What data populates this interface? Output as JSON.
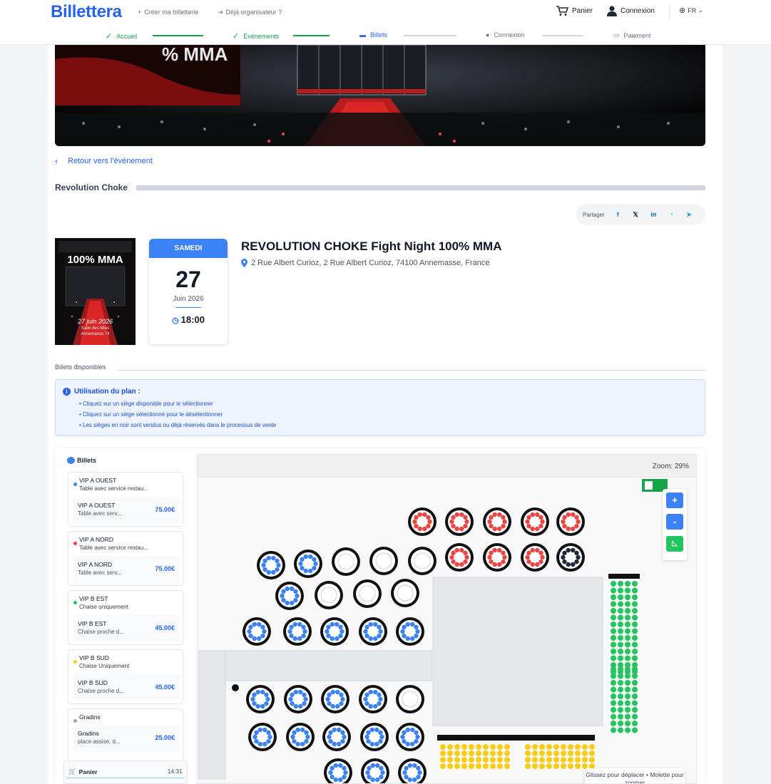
{
  "header": {
    "logo": "Billettera",
    "create_link": "Créer ma billetterie",
    "organizer_link": "Déjà organisateur ?",
    "cart": "Panier",
    "login": "Connexion",
    "lang": "FR"
  },
  "steps": [
    {
      "label": "Accueil",
      "state": "done"
    },
    {
      "label": "Événements",
      "state": "done"
    },
    {
      "label": "Billets",
      "state": "active"
    },
    {
      "label": "Connexion",
      "state": "pending"
    },
    {
      "label": "Paiement",
      "state": "pending"
    }
  ],
  "back_link": "Retour vers l'événement",
  "event_section_title": "Revolution Choke",
  "share": {
    "label": "Partager",
    "icons": [
      "f",
      "𝕏",
      "in",
      "◔",
      "➤"
    ]
  },
  "poster": {
    "headline": "100% MMA",
    "date_text": "27 juin 2026",
    "line2": "Salle des fêtes",
    "line3": "Annemasse 74"
  },
  "date_card": {
    "weekday": "SAMEDI",
    "day": "27",
    "month_year": "Juin 2026",
    "time": "18:00"
  },
  "event": {
    "title": "REVOLUTION CHOKE Fight Night 100% MMA",
    "address": "2 Rue Albert Curioz, 2 Rue Albert Curioz, 74100 Annemasse, France"
  },
  "tickets_available_label": "Billets disponibles",
  "plan_info": {
    "title": "Utilisation du plan :",
    "bullets": [
      "• Cliquez sur un siège disponible pour le sélectionner",
      "• Cliquez sur un siège sélectionné pour le désélectionner",
      "• Les sièges en noir sont vendus ou déjà réservés dans le processus de vente"
    ]
  },
  "tickets_panel": {
    "title": "Billets",
    "categories": [
      {
        "name": "VIP A OUEST",
        "desc": "Table avec service restau...",
        "item_name": "VIP A OUEST",
        "item_desc": "Table avec serv...",
        "price": "75.00€",
        "color": "#3b82f6"
      },
      {
        "name": "VIP A NORD",
        "desc": "Table avec service restau...",
        "item_name": "VIP A NORD",
        "item_desc": "Table avec serv...",
        "price": "75.00€",
        "color": "#ef4444"
      },
      {
        "name": "VIP B EST",
        "desc": "Chaise uniquement",
        "item_name": "VIP B EST",
        "item_desc": "Chaise proche d...",
        "price": "45.00€",
        "color": "#22c55e"
      },
      {
        "name": "VIP B SUD",
        "desc": "Chaise Uniquement",
        "item_name": "VIP B SUD",
        "item_desc": "Chaise proche d...",
        "price": "45.00€",
        "color": "#facc15"
      },
      {
        "name": "Gradins",
        "desc": "",
        "item_name": "Gradins",
        "item_desc": "place assise, d...",
        "price": "25.00€",
        "color": "#9ca3af"
      }
    ]
  },
  "cart_panel": {
    "label": "Panier",
    "timer": "14:31"
  },
  "map": {
    "zoom_label": "Zoom: 29%",
    "zoom_in": "+",
    "zoom_out": "-",
    "hint": "Glissez pour déplacer • Molette pour zoomer",
    "colors": {
      "ouest": "#3b82f6",
      "nord": "#ef4444",
      "est": "#22c55e",
      "sud": "#facc15",
      "sold": "#1f2937"
    }
  }
}
